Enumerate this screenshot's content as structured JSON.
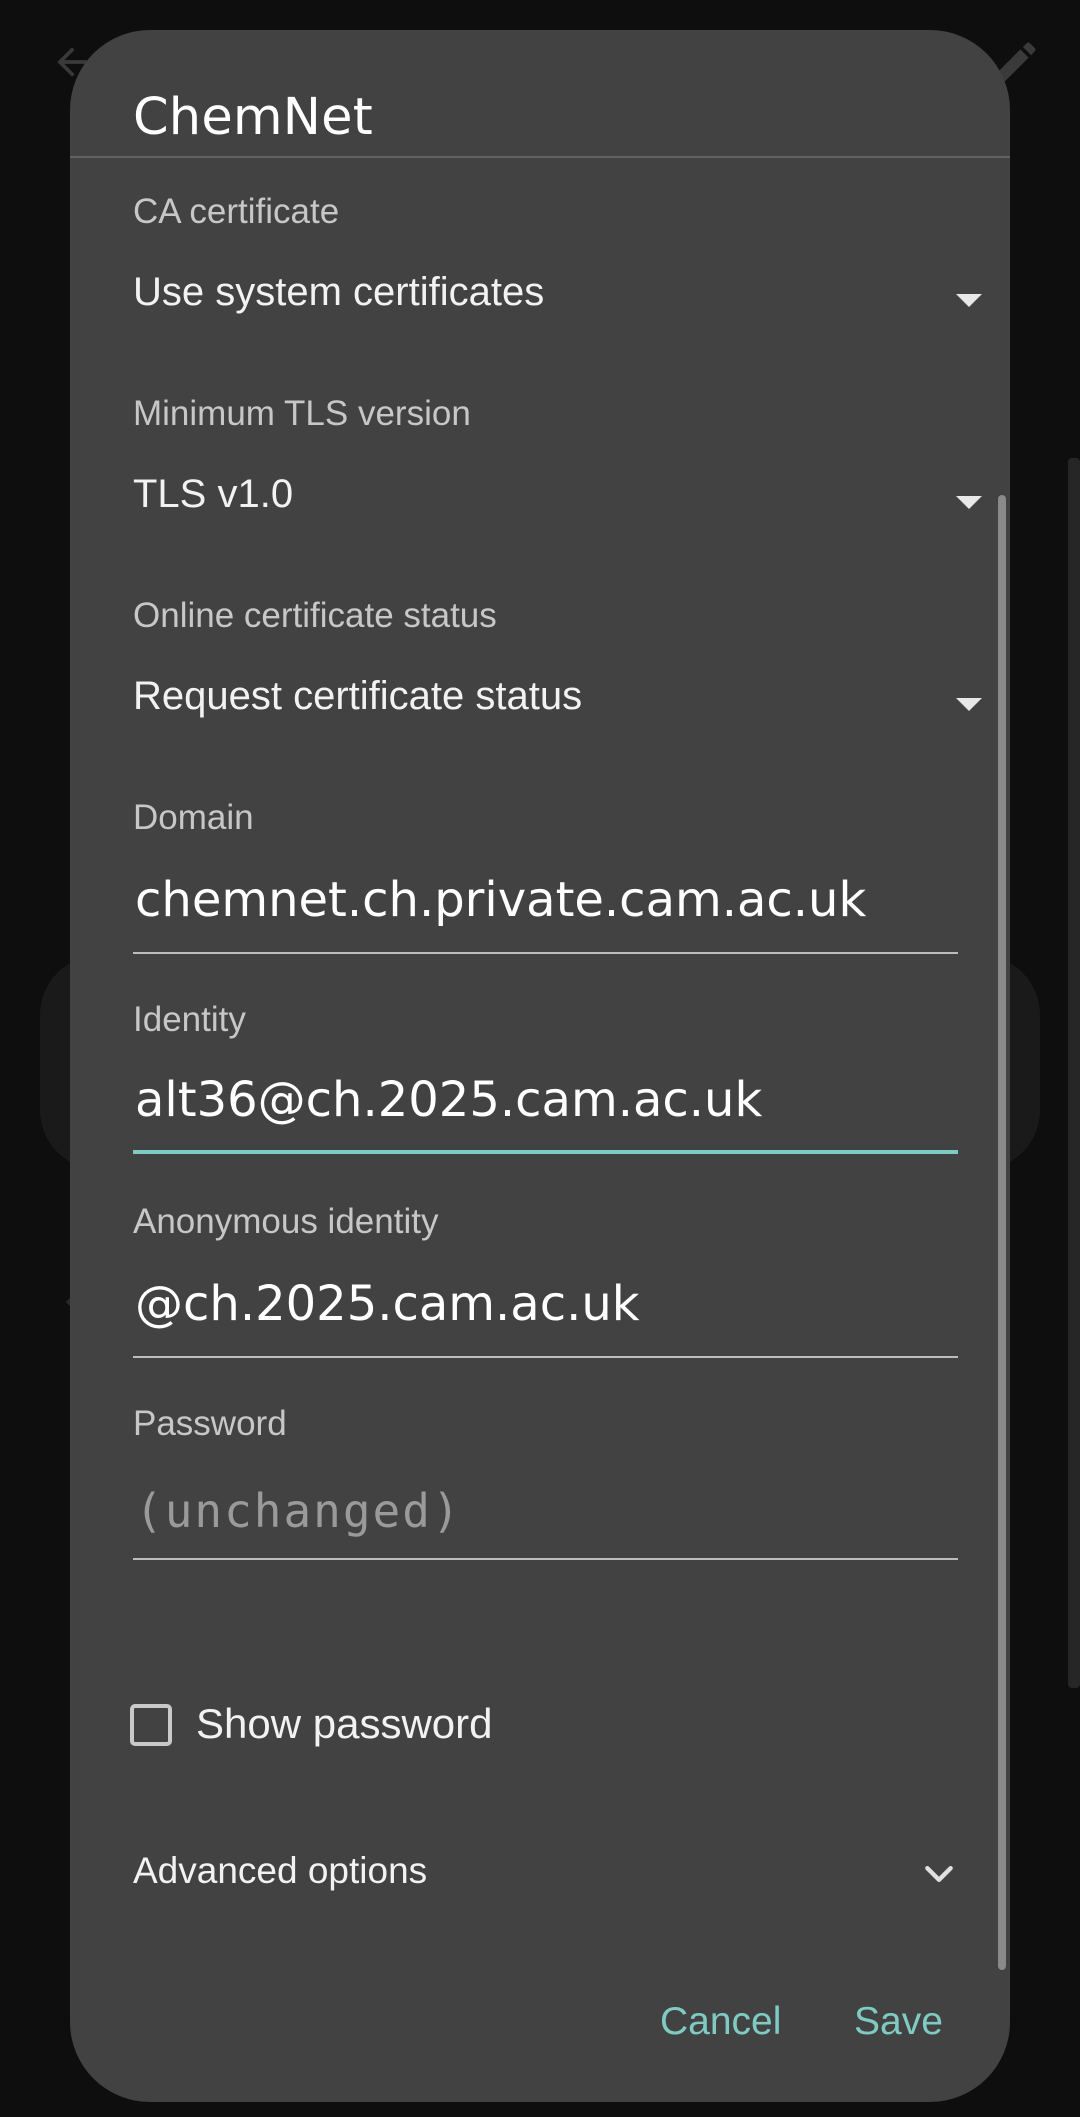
{
  "dialog": {
    "title": "ChemNet",
    "fields": {
      "ca_certificate": {
        "label": "CA certificate",
        "value": "Use system certificates"
      },
      "min_tls": {
        "label": "Minimum TLS version",
        "value": "TLS v1.0"
      },
      "ocsp": {
        "label": "Online certificate status",
        "value": "Request certificate status"
      },
      "domain": {
        "label": "Domain",
        "value": "chemnet.ch.private.cam.ac.uk"
      },
      "identity": {
        "label": "Identity",
        "value": "alt36@ch.2025.cam.ac.uk"
      },
      "anonymous_identity": {
        "label": "Anonymous identity",
        "value": "@ch.2025.cam.ac.uk"
      },
      "password": {
        "label": "Password",
        "placeholder": "(unchanged)"
      }
    },
    "show_password": {
      "label": "Show password",
      "checked": false
    },
    "advanced": {
      "label": "Advanced options"
    },
    "buttons": {
      "cancel": "Cancel",
      "save": "Save"
    }
  },
  "colors": {
    "dialog_bg": "#424242",
    "accent": "#7fcbc4",
    "scrim": "#0e0e0e"
  }
}
